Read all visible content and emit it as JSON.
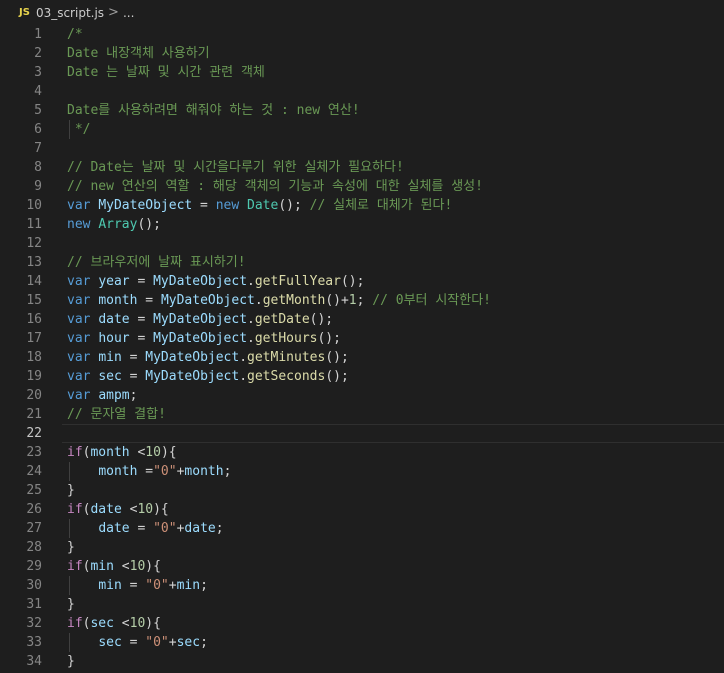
{
  "breadcrumb": {
    "file_icon": "JS",
    "file_name": "03_script.js",
    "separator": ">",
    "more": "..."
  },
  "editor": {
    "active_line": 22,
    "lines": [
      {
        "n": "1",
        "tokens": [
          {
            "t": "/*",
            "c": "c"
          }
        ]
      },
      {
        "n": "2",
        "tokens": [
          {
            "t": "Date 내장객체 사용하기",
            "c": "c"
          }
        ]
      },
      {
        "n": "3",
        "tokens": [
          {
            "t": "Date 는 날짜 및 시간 관련 객체",
            "c": "c"
          }
        ]
      },
      {
        "n": "4",
        "tokens": []
      },
      {
        "n": "5",
        "tokens": [
          {
            "t": "Date를 사용하려면 해줘야 하는 것 : new 연산!",
            "c": "c"
          }
        ]
      },
      {
        "n": "6",
        "tokens": [
          {
            "t": " */",
            "c": "c"
          }
        ],
        "guide": true
      },
      {
        "n": "7",
        "tokens": []
      },
      {
        "n": "8",
        "tokens": [
          {
            "t": "// Date는 날짜 및 시간을다루기 위한 실체가 필요하다!",
            "c": "c"
          }
        ]
      },
      {
        "n": "9",
        "tokens": [
          {
            "t": "// new 연산의 역할 : 해당 객체의 기능과 속성에 대한 실체를 생성!",
            "c": "c"
          }
        ]
      },
      {
        "n": "10",
        "tokens": [
          {
            "t": "var ",
            "c": "k"
          },
          {
            "t": "MyDateObject",
            "c": "v"
          },
          {
            "t": " = ",
            "c": ""
          },
          {
            "t": "new ",
            "c": "k"
          },
          {
            "t": "Date",
            "c": "t"
          },
          {
            "t": "(); ",
            "c": ""
          },
          {
            "t": "// 실체로 대체가 된다!",
            "c": "c"
          }
        ]
      },
      {
        "n": "11",
        "tokens": [
          {
            "t": "new ",
            "c": "k"
          },
          {
            "t": "Array",
            "c": "t"
          },
          {
            "t": "();",
            "c": ""
          }
        ]
      },
      {
        "n": "12",
        "tokens": []
      },
      {
        "n": "13",
        "tokens": [
          {
            "t": "// 브라우저에 날짜 표시하기!",
            "c": "c"
          }
        ]
      },
      {
        "n": "14",
        "tokens": [
          {
            "t": "var ",
            "c": "k"
          },
          {
            "t": "year",
            "c": "v"
          },
          {
            "t": " = ",
            "c": ""
          },
          {
            "t": "MyDateObject",
            "c": "v"
          },
          {
            "t": ".",
            "c": ""
          },
          {
            "t": "getFullYear",
            "c": "f"
          },
          {
            "t": "();",
            "c": ""
          }
        ]
      },
      {
        "n": "15",
        "tokens": [
          {
            "t": "var ",
            "c": "k"
          },
          {
            "t": "month",
            "c": "v"
          },
          {
            "t": " = ",
            "c": ""
          },
          {
            "t": "MyDateObject",
            "c": "v"
          },
          {
            "t": ".",
            "c": ""
          },
          {
            "t": "getMonth",
            "c": "f"
          },
          {
            "t": "()+",
            "c": ""
          },
          {
            "t": "1",
            "c": "n"
          },
          {
            "t": "; ",
            "c": ""
          },
          {
            "t": "// 0부터 시작한다!",
            "c": "c"
          }
        ]
      },
      {
        "n": "16",
        "tokens": [
          {
            "t": "var ",
            "c": "k"
          },
          {
            "t": "date",
            "c": "v"
          },
          {
            "t": " = ",
            "c": ""
          },
          {
            "t": "MyDateObject",
            "c": "v"
          },
          {
            "t": ".",
            "c": ""
          },
          {
            "t": "getDate",
            "c": "f"
          },
          {
            "t": "();",
            "c": ""
          }
        ]
      },
      {
        "n": "17",
        "tokens": [
          {
            "t": "var ",
            "c": "k"
          },
          {
            "t": "hour",
            "c": "v"
          },
          {
            "t": " = ",
            "c": ""
          },
          {
            "t": "MyDateObject",
            "c": "v"
          },
          {
            "t": ".",
            "c": ""
          },
          {
            "t": "getHours",
            "c": "f"
          },
          {
            "t": "();",
            "c": ""
          }
        ]
      },
      {
        "n": "18",
        "tokens": [
          {
            "t": "var ",
            "c": "k"
          },
          {
            "t": "min",
            "c": "v"
          },
          {
            "t": " = ",
            "c": ""
          },
          {
            "t": "MyDateObject",
            "c": "v"
          },
          {
            "t": ".",
            "c": ""
          },
          {
            "t": "getMinutes",
            "c": "f"
          },
          {
            "t": "();",
            "c": ""
          }
        ]
      },
      {
        "n": "19",
        "tokens": [
          {
            "t": "var ",
            "c": "k"
          },
          {
            "t": "sec",
            "c": "v"
          },
          {
            "t": " = ",
            "c": ""
          },
          {
            "t": "MyDateObject",
            "c": "v"
          },
          {
            "t": ".",
            "c": ""
          },
          {
            "t": "getSeconds",
            "c": "f"
          },
          {
            "t": "();",
            "c": ""
          }
        ]
      },
      {
        "n": "20",
        "tokens": [
          {
            "t": "var ",
            "c": "k"
          },
          {
            "t": "ampm",
            "c": "v"
          },
          {
            "t": ";",
            "c": ""
          }
        ]
      },
      {
        "n": "21",
        "tokens": [
          {
            "t": "// 문자열 결합!",
            "c": "c"
          }
        ]
      },
      {
        "n": "22",
        "tokens": []
      },
      {
        "n": "23",
        "tokens": [
          {
            "t": "if",
            "c": "cf"
          },
          {
            "t": "(",
            "c": ""
          },
          {
            "t": "month",
            "c": "v"
          },
          {
            "t": " <",
            "c": ""
          },
          {
            "t": "10",
            "c": "n"
          },
          {
            "t": "){",
            "c": ""
          }
        ]
      },
      {
        "n": "24",
        "tokens": [
          {
            "t": "    ",
            "c": ""
          },
          {
            "t": "month",
            "c": "v"
          },
          {
            "t": " =",
            "c": ""
          },
          {
            "t": "\"0\"",
            "c": "s"
          },
          {
            "t": "+",
            "c": ""
          },
          {
            "t": "month",
            "c": "v"
          },
          {
            "t": ";",
            "c": ""
          }
        ],
        "guide": true
      },
      {
        "n": "25",
        "tokens": [
          {
            "t": "}",
            "c": ""
          }
        ]
      },
      {
        "n": "26",
        "tokens": [
          {
            "t": "if",
            "c": "cf"
          },
          {
            "t": "(",
            "c": ""
          },
          {
            "t": "date",
            "c": "v"
          },
          {
            "t": " <",
            "c": ""
          },
          {
            "t": "10",
            "c": "n"
          },
          {
            "t": "){",
            "c": ""
          }
        ]
      },
      {
        "n": "27",
        "tokens": [
          {
            "t": "    ",
            "c": ""
          },
          {
            "t": "date",
            "c": "v"
          },
          {
            "t": " = ",
            "c": ""
          },
          {
            "t": "\"0\"",
            "c": "s"
          },
          {
            "t": "+",
            "c": ""
          },
          {
            "t": "date",
            "c": "v"
          },
          {
            "t": ";",
            "c": ""
          }
        ],
        "guide": true
      },
      {
        "n": "28",
        "tokens": [
          {
            "t": "}",
            "c": ""
          }
        ]
      },
      {
        "n": "29",
        "tokens": [
          {
            "t": "if",
            "c": "cf"
          },
          {
            "t": "(",
            "c": ""
          },
          {
            "t": "min",
            "c": "v"
          },
          {
            "t": " <",
            "c": ""
          },
          {
            "t": "10",
            "c": "n"
          },
          {
            "t": "){",
            "c": ""
          }
        ]
      },
      {
        "n": "30",
        "tokens": [
          {
            "t": "    ",
            "c": ""
          },
          {
            "t": "min",
            "c": "v"
          },
          {
            "t": " = ",
            "c": ""
          },
          {
            "t": "\"0\"",
            "c": "s"
          },
          {
            "t": "+",
            "c": ""
          },
          {
            "t": "min",
            "c": "v"
          },
          {
            "t": ";",
            "c": ""
          }
        ],
        "guide": true
      },
      {
        "n": "31",
        "tokens": [
          {
            "t": "}",
            "c": ""
          }
        ]
      },
      {
        "n": "32",
        "tokens": [
          {
            "t": "if",
            "c": "cf"
          },
          {
            "t": "(",
            "c": ""
          },
          {
            "t": "sec",
            "c": "v"
          },
          {
            "t": " <",
            "c": ""
          },
          {
            "t": "10",
            "c": "n"
          },
          {
            "t": "){",
            "c": ""
          }
        ]
      },
      {
        "n": "33",
        "tokens": [
          {
            "t": "    ",
            "c": ""
          },
          {
            "t": "sec",
            "c": "v"
          },
          {
            "t": " = ",
            "c": ""
          },
          {
            "t": "\"0\"",
            "c": "s"
          },
          {
            "t": "+",
            "c": ""
          },
          {
            "t": "sec",
            "c": "v"
          },
          {
            "t": ";",
            "c": ""
          }
        ],
        "guide": true
      },
      {
        "n": "34",
        "tokens": [
          {
            "t": "}",
            "c": ""
          }
        ]
      }
    ]
  }
}
